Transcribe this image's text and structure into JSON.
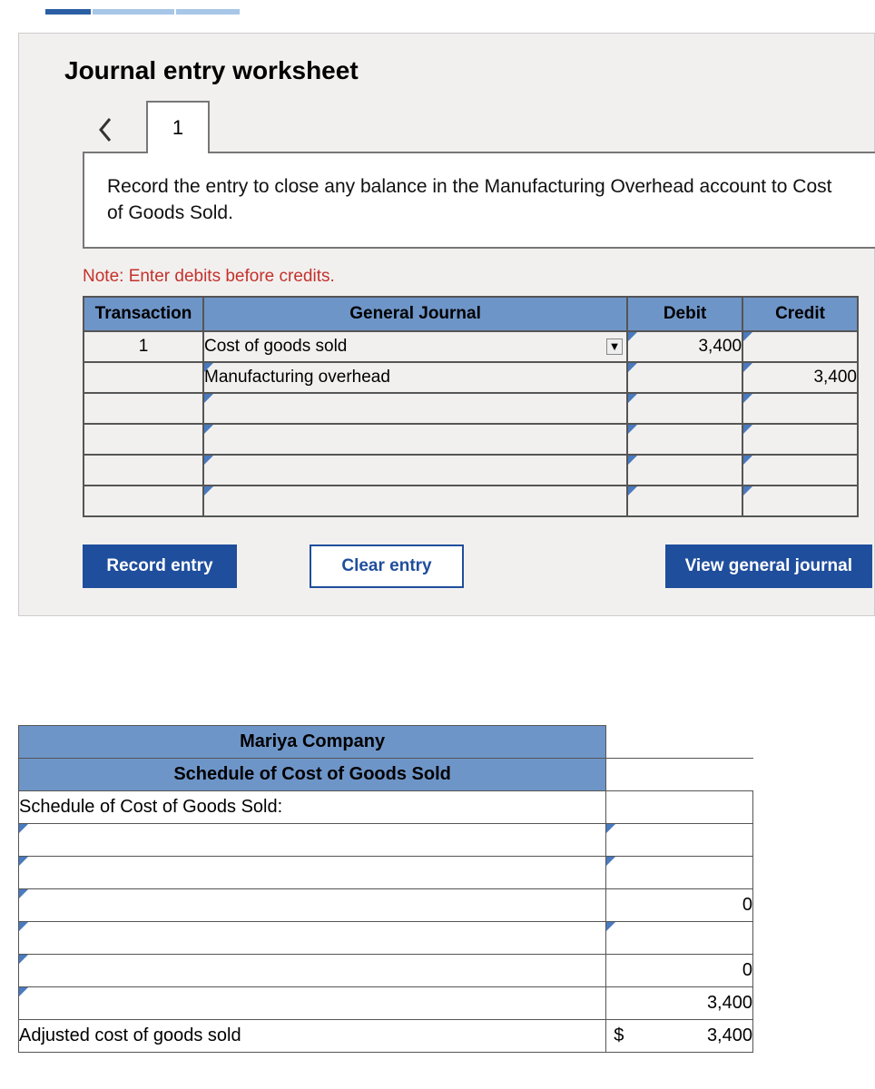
{
  "worksheet": {
    "title": "Journal entry worksheet",
    "tab_label": "1",
    "instruction": "Record the entry to close any balance in the Manufacturing Overhead account to Cost of Goods Sold.",
    "note": "Note: Enter debits before credits.",
    "headers": {
      "transaction": "Transaction",
      "general_journal": "General Journal",
      "debit": "Debit",
      "credit": "Credit"
    },
    "rows": [
      {
        "trans": "1",
        "journal": "Cost of goods sold",
        "debit": "3,400",
        "credit": ""
      },
      {
        "trans": "",
        "journal": "Manufacturing overhead",
        "debit": "",
        "credit": "3,400"
      },
      {
        "trans": "",
        "journal": "",
        "debit": "",
        "credit": ""
      },
      {
        "trans": "",
        "journal": "",
        "debit": "",
        "credit": ""
      },
      {
        "trans": "",
        "journal": "",
        "debit": "",
        "credit": ""
      },
      {
        "trans": "",
        "journal": "",
        "debit": "",
        "credit": ""
      }
    ],
    "buttons": {
      "record": "Record entry",
      "clear": "Clear entry",
      "view": "View general journal"
    }
  },
  "schedule": {
    "company": "Mariya Company",
    "title": "Schedule of Cost of Goods Sold",
    "label_row": "Schedule of Cost of Goods Sold:",
    "rows": [
      {
        "label": "",
        "value": ""
      },
      {
        "label": "",
        "value": ""
      },
      {
        "label": "",
        "value": "0"
      },
      {
        "label": "",
        "value": ""
      },
      {
        "label": "",
        "value": "0"
      },
      {
        "label": "",
        "value": "3,400"
      }
    ],
    "final_label": "Adjusted cost of goods sold",
    "final_symbol": "$",
    "final_value": "3,400"
  }
}
